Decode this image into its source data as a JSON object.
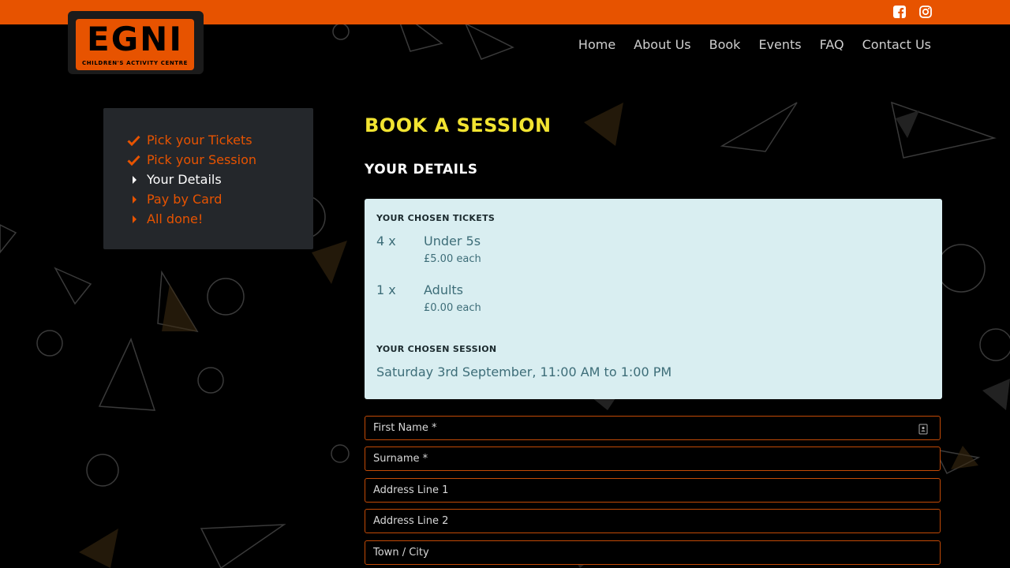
{
  "colors": {
    "brand_orange": "#e75300",
    "title_yellow": "#f2e431",
    "summary_bg": "#d9eef1",
    "summary_text": "#3d6d78",
    "panel_bg": "#24272b"
  },
  "topbar": {
    "social_icons": [
      "facebook-icon",
      "instagram-icon"
    ]
  },
  "logo": {
    "word": "EGNI",
    "tagline": "CHILDREN'S ACTIVITY CENTRE"
  },
  "nav": {
    "items": [
      {
        "label": "Home"
      },
      {
        "label": "About Us"
      },
      {
        "label": "Book"
      },
      {
        "label": "Events"
      },
      {
        "label": "FAQ"
      },
      {
        "label": "Contact Us"
      }
    ]
  },
  "steps": [
    {
      "label": "Pick your Tickets",
      "status": "done",
      "icon": "check-icon"
    },
    {
      "label": "Pick your Session",
      "status": "done",
      "icon": "check-icon"
    },
    {
      "label": "Your Details",
      "status": "current",
      "icon": "caret-right-icon"
    },
    {
      "label": "Pay by Card",
      "status": "todo",
      "icon": "caret-right-icon"
    },
    {
      "label": "All done!",
      "status": "todo",
      "icon": "caret-right-icon"
    }
  ],
  "main": {
    "title": "BOOK A SESSION",
    "section_title": "YOUR DETAILS",
    "summary": {
      "tickets_heading": "YOUR CHOSEN TICKETS",
      "tickets": [
        {
          "qty": "4 x",
          "name": "Under 5s",
          "price": "£5.00 each"
        },
        {
          "qty": "1 x",
          "name": "Adults",
          "price": "£0.00 each"
        }
      ],
      "session_heading": "YOUR CHOSEN SESSION",
      "session": "Saturday 3rd September, 11:00 AM to 1:00 PM"
    },
    "form": {
      "fields": [
        {
          "placeholder": "First Name *",
          "autofill_icon": "contact-card-icon"
        },
        {
          "placeholder": "Surname *"
        },
        {
          "placeholder": "Address Line 1"
        },
        {
          "placeholder": "Address Line 2"
        },
        {
          "placeholder": "Town / City"
        }
      ]
    }
  }
}
